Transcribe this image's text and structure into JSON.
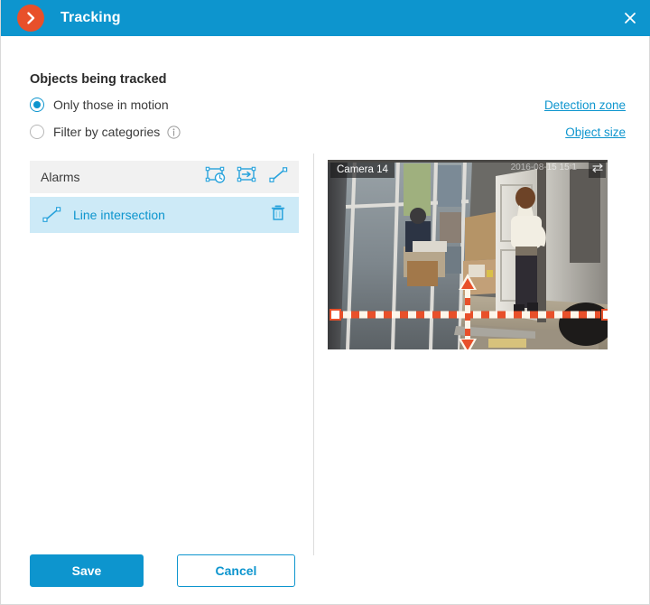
{
  "window": {
    "title": "Tracking",
    "badge_icon": "chevron-right-icon",
    "close_icon": "close-icon",
    "accent_color": "#0d95ce",
    "badge_color": "#e8502a"
  },
  "tracking": {
    "section_title": "Objects being tracked",
    "options": [
      {
        "label": "Only those in motion",
        "selected": true,
        "info": false
      },
      {
        "label": "Filter by categories",
        "selected": false,
        "info": true,
        "info_icon": "info-icon"
      }
    ],
    "links": [
      {
        "label": "Detection zone",
        "name": "detection-zone-link"
      },
      {
        "label": "Object size",
        "name": "object-size-link"
      }
    ]
  },
  "alarms": {
    "header_label": "Alarms",
    "tools": [
      {
        "name": "loitering-zone-icon",
        "title": "rectangle-with-clock"
      },
      {
        "name": "zone-crossing-icon",
        "title": "rectangle-with-arrow"
      },
      {
        "name": "line-intersection-icon",
        "title": "diagonal-line"
      }
    ],
    "rows": [
      {
        "label": "Line intersection",
        "icon": "line-intersection-icon",
        "delete_icon": "trash-icon",
        "selected": true
      }
    ]
  },
  "preview": {
    "camera_label": "Camera 14",
    "timestamp": "2016-08-15 15:1",
    "swap_icon": "swap-icon",
    "line": {
      "color": "#e8502a",
      "dash_color": "#ffffff",
      "direction_indicator": "bidirectional-vertical-arrow"
    }
  },
  "footer": {
    "save_label": "Save",
    "cancel_label": "Cancel"
  }
}
